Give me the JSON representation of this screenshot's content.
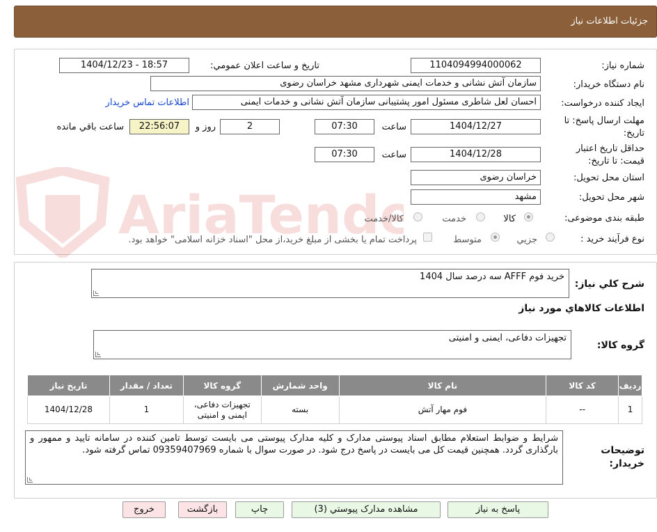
{
  "header": {
    "title": "جزئیات اطلاعات نیاز"
  },
  "watermark": {
    "text": "AriaTender.neT"
  },
  "fields": {
    "need_number_label": "شماره نیاز:",
    "need_number": "1104094994000062",
    "announce_label": "تاریخ و ساعت اعلان عمومي:",
    "announce_value": "1404/12/23 - 18:57",
    "buyer_org_label": "نام دستگاه خریدار:",
    "buyer_org": "سازمان آتش نشانی و خدمات ایمنی شهرداری مشهد خراسان رضوی",
    "requester_label": "ایجاد کننده درخواست:",
    "requester": "احسان لعل شاطری مسئول امور پشتیبانی سازمان آتش نشانی و خدمات ایمنی",
    "buyer_contact_link": "اطلاعات تماس خریدار",
    "deadline_label_1": "مهلت ارسال پاسخ: تا",
    "deadline_label_2": "تاریخ:",
    "deadline_date": "1404/12/27",
    "time_label": "ساعت",
    "deadline_time": "07:30",
    "days_value": "2",
    "days_label": "روز و",
    "remaining_time": "22:56:07",
    "remaining_label": "ساعت باقي مانده",
    "price_validity_label_1": "حداقل تاریخ اعتبار",
    "price_validity_label_2": "قیمت: تا تاریخ:",
    "price_validity_date": "1404/12/28",
    "price_validity_time": "07:30",
    "province_label": "استان محل تحویل:",
    "province": "خراسان رضوی",
    "city_label": "شهر محل تحویل:",
    "city": "مشهد",
    "category_label": "طبقه بندی موضوعی:",
    "category_options": [
      "کالا",
      "خدمت",
      "کالا/خدمت"
    ],
    "process_label": "نوع فرآیند خرید :",
    "process_options": [
      "جزیي",
      "متوسط"
    ],
    "treasury_note": "پرداخت تمام یا بخشی از مبلغ خرید،از محل \"اسناد خزانه اسلامی\" خواهد بود."
  },
  "summary": {
    "label": "شرح کلي نیاز:",
    "value": "خرید فوم AFFF سه درصد سال 1404",
    "goods_info_title": "اطلاعات کالاهاي مورد نیاز",
    "goods_group_label": "گروه کالا:",
    "goods_group": "تجهیزات دفاعی، ایمنی و امنیتی"
  },
  "table": {
    "headers": [
      "ردیف",
      "کد کالا",
      "نام کالا",
      "واحد شمارش",
      "گروه کالا",
      "تعداد / مقدار",
      "تاریخ نیاز"
    ],
    "rows": [
      [
        "1",
        "--",
        "فوم مهار آتش",
        "بسته",
        "تجهیزات دفاعی، ایمنی و امنیتی",
        "1",
        "1404/12/28"
      ]
    ]
  },
  "notes": {
    "label_1": "توضیحات",
    "label_2": "خریدار:",
    "text": "شرایط و ضوابط استعلام مطابق اسناد پیوستی مدارک و کلیه مدارک پیوستی می بایست توسط تامین کننده در سامانه تایید و ممهور و بارگذاری گردد. همچنین قیمت کل می بایست در پاسخ درج شود. در صورت سوال با شماره 09359407969 تماس گرفته شود."
  },
  "buttons": {
    "reply": "پاسخ به نیاز",
    "attachments": "مشاهده مدارک پیوستي (3)",
    "print": "چاپ",
    "back": "بازگشت",
    "exit": "خروج"
  }
}
